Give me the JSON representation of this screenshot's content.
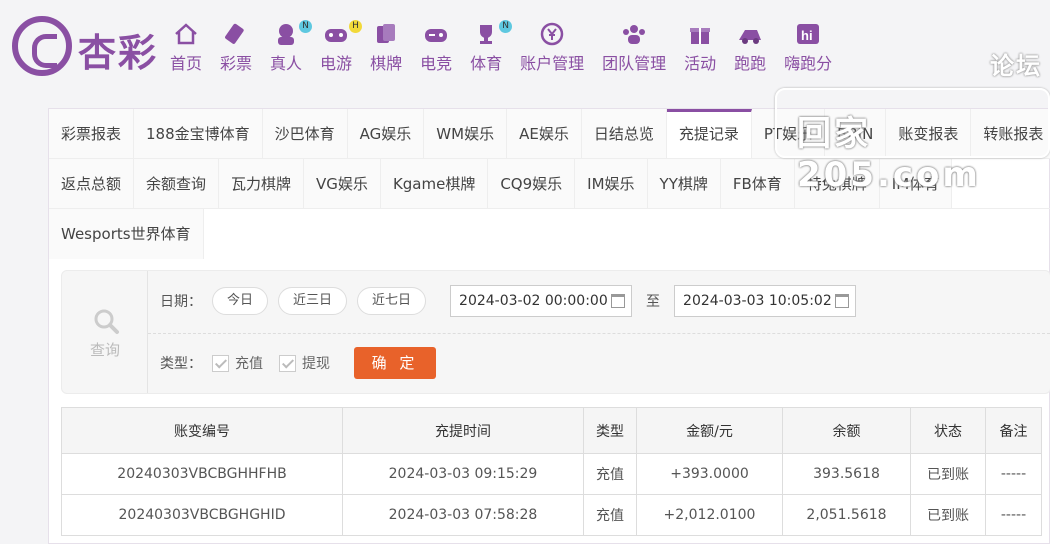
{
  "brand": {
    "name": "杏彩"
  },
  "nav": [
    {
      "label": "首页",
      "icon": "home-icon",
      "badge": ""
    },
    {
      "label": "彩票",
      "icon": "lottery-ticket-icon",
      "badge": ""
    },
    {
      "label": "真人",
      "icon": "live-dealer-icon",
      "badge": "N"
    },
    {
      "label": "电游",
      "icon": "gamepad-icon",
      "badge": "H"
    },
    {
      "label": "棋牌",
      "icon": "cards-icon",
      "badge": ""
    },
    {
      "label": "电竞",
      "icon": "esports-controller-icon",
      "badge": ""
    },
    {
      "label": "体育",
      "icon": "trophy-icon",
      "badge": "N"
    },
    {
      "label": "账户管理",
      "icon": "yuan-coin-icon",
      "badge": ""
    },
    {
      "label": "团队管理",
      "icon": "team-icon",
      "badge": ""
    },
    {
      "label": "活动",
      "icon": "gift-icon",
      "badge": ""
    },
    {
      "label": "跑跑",
      "icon": "race-icon",
      "badge": ""
    },
    {
      "label": "嗨跑分",
      "icon": "hi-icon",
      "badge": ""
    }
  ],
  "watermark": {
    "line1": "论坛",
    "line2": "回家205.com"
  },
  "tabs_row1": [
    "彩票报表",
    "188金宝博体育",
    "沙巴体育",
    "AG娱乐",
    "WM娱乐",
    "AE娱乐",
    "日结总览",
    "充提记录",
    "PT娱乐",
    "BBIN",
    "账变报表",
    "转账报表"
  ],
  "tabs_row2": [
    "返点总额",
    "余额查询",
    "瓦力棋牌",
    "VG娱乐",
    "Kgame棋牌",
    "CQ9娱乐",
    "IM娱乐",
    "YY棋牌",
    "FB体育",
    "特兔棋牌",
    "IM体育"
  ],
  "tabs_row3": [
    "Wesports世界体育"
  ],
  "active_tab": "充提记录",
  "filter": {
    "query_label": "查询",
    "date_label": "日期：",
    "quick_ranges": [
      "今日",
      "近三日",
      "近七日"
    ],
    "start": "2024-03-02 00:00:00",
    "to_label": "至",
    "end": "2024-03-03 10:05:02",
    "type_label": "类型：",
    "types": [
      "充值",
      "提现"
    ],
    "confirm_label": "确 定"
  },
  "table": {
    "headers": [
      "账变编号",
      "充提时间",
      "类型",
      "金额/元",
      "余额",
      "状态",
      "备注"
    ],
    "rows": [
      [
        "20240303VBCBGHHFHB",
        "2024-03-03 09:15:29",
        "充值",
        "+393.0000",
        "393.5618",
        "已到账",
        "-----"
      ],
      [
        "20240303VBCBGHGHID",
        "2024-03-03 07:58:28",
        "充值",
        "+2,012.0100",
        "2,051.5618",
        "已到账",
        "-----"
      ]
    ]
  },
  "colors": {
    "brand": "#8a4fa3",
    "confirm": "#e8622a",
    "amount": "#d8332c",
    "status_ok": "#48a040"
  }
}
